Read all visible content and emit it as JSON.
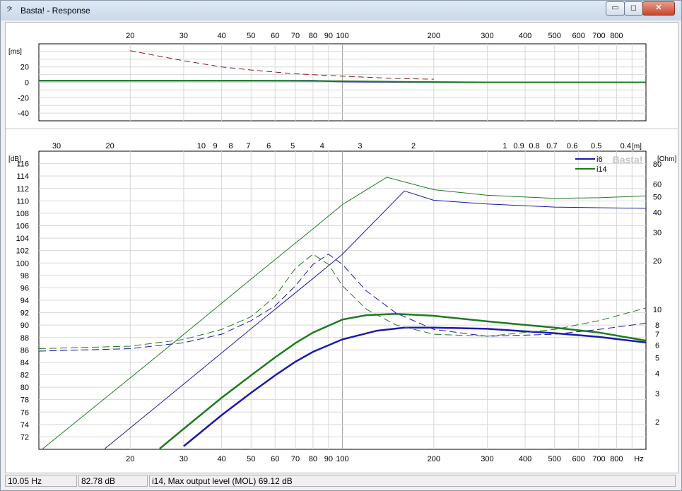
{
  "window": {
    "title": "Basta! - Response",
    "icon": "bass-clef-icon",
    "minimize_glyph": "▭",
    "maximize_glyph": "◻",
    "close_glyph": "✕"
  },
  "colors": {
    "i6": "#1a1aa8",
    "i14": "#1f7a1f",
    "delay_dashed": "#8b1a1a",
    "grid": "#d8d8d8",
    "grid_decade": "#a8a8a8"
  },
  "chart_data": [
    {
      "type": "line",
      "name": "group-delay",
      "x_scale": "log",
      "xlim": [
        10,
        1000
      ],
      "x_ticks": [
        20,
        30,
        40,
        50,
        60,
        70,
        80,
        90,
        100,
        200,
        300,
        400,
        500,
        600,
        700,
        800
      ],
      "y_unit": "[ms]",
      "ylim": [
        -50,
        50
      ],
      "y_ticks": [
        20,
        0,
        -20,
        -40
      ],
      "grid": true,
      "series": [
        {
          "line": "dashed",
          "x": [
            20,
            30,
            40,
            50,
            70,
            100,
            150,
            200
          ],
          "y": [
            41,
            28,
            20,
            16,
            11,
            8,
            5,
            4
          ]
        },
        {
          "line": "solid",
          "x": [
            10,
            50,
            80,
            100,
            150,
            250,
            1000
          ],
          "y": [
            2,
            2,
            2,
            1,
            0.5,
            0,
            0
          ]
        },
        {
          "line": "solid",
          "x": [
            10,
            50,
            100,
            150,
            200,
            300,
            1000
          ],
          "y": [
            2,
            2,
            1.5,
            0.8,
            0.4,
            0,
            0
          ]
        }
      ]
    },
    {
      "type": "line",
      "name": "response",
      "x_scale": "log",
      "xlim": [
        10,
        1000
      ],
      "x_ticks": [
        20,
        30,
        40,
        50,
        60,
        70,
        80,
        90,
        100,
        200,
        300,
        400,
        500,
        600,
        700,
        800
      ],
      "x_unit": "Hz",
      "top_axis_unit": "[m]",
      "top_ticks": [
        "30",
        "20",
        "10",
        "9",
        "8",
        "7",
        "6",
        "5",
        "4",
        "3",
        "2",
        "1",
        "0.9",
        "0.8",
        "0.7",
        "0.6",
        "0.5",
        "0.4"
      ],
      "y_unit": "[dB]",
      "ylim": [
        70,
        118
      ],
      "y_ticks": [
        72,
        74,
        76,
        78,
        80,
        82,
        84,
        86,
        88,
        90,
        92,
        94,
        96,
        98,
        100,
        102,
        104,
        106,
        108,
        110,
        112,
        114,
        116
      ],
      "y2_unit": "[Ohm]",
      "y2_scale": "log",
      "y2_ticks": [
        2,
        3,
        4,
        5,
        6,
        7,
        8,
        10,
        20,
        30,
        40,
        50,
        60,
        80
      ],
      "grid": true,
      "legend": [
        "i6",
        "i14"
      ],
      "legend_position": "top-right",
      "watermark": "Basta!",
      "series": [
        {
          "name": "i6",
          "role": "response",
          "x": [
            30,
            40,
            50,
            60,
            70,
            80,
            100,
            130,
            160,
            200,
            300,
            400,
            500,
            700,
            1000
          ],
          "y": [
            70.5,
            75.5,
            79.1,
            81.9,
            84.1,
            85.7,
            87.7,
            89.1,
            89.6,
            89.6,
            89.4,
            89,
            88.7,
            88.1,
            87.2
          ]
        },
        {
          "name": "i14",
          "role": "response",
          "x": [
            25,
            30,
            40,
            50,
            60,
            70,
            80,
            100,
            120,
            150,
            200,
            300,
            500,
            700,
            1000
          ],
          "y": [
            70.1,
            73.3,
            78.3,
            81.9,
            84.8,
            87.1,
            88.8,
            90.9,
            91.6,
            91.8,
            91.5,
            90.6,
            89.6,
            88.8,
            87.5
          ]
        },
        {
          "name": "i6",
          "role": "max-level",
          "x": [
            16.5,
            30,
            50,
            80,
            100,
            160,
            200,
            300,
            500,
            1000
          ],
          "y": [
            70.1,
            80.5,
            89.4,
            97.5,
            101.4,
            111.6,
            110.1,
            109.5,
            109,
            108.8
          ]
        },
        {
          "name": "i14",
          "role": "max-level",
          "x": [
            10.3,
            20,
            30,
            50,
            80,
            100,
            140,
            200,
            300,
            500,
            700,
            1000
          ],
          "y": [
            70.1,
            81.5,
            88.5,
            97.4,
            105.5,
            109.4,
            113.8,
            111.8,
            110.9,
            110.4,
            110.5,
            110.8
          ]
        },
        {
          "name": "i6",
          "role": "impedance",
          "x": [
            10,
            20,
            30,
            40,
            50,
            60,
            70,
            80,
            90,
            100,
            120,
            150,
            200,
            300,
            500,
            700,
            1000
          ],
          "y": [
            5.5,
            5.7,
            6.2,
            7.0,
            8.5,
            10.5,
            14,
            19,
            22,
            19,
            13,
            9.5,
            7.5,
            6.8,
            7.0,
            7.5,
            8.2
          ]
        },
        {
          "name": "i14",
          "role": "impedance",
          "x": [
            10,
            20,
            30,
            40,
            50,
            60,
            70,
            80,
            90,
            100,
            120,
            150,
            200,
            300,
            500,
            700,
            1000
          ],
          "y": [
            5.7,
            5.9,
            6.5,
            7.5,
            9.0,
            12,
            18,
            22,
            19,
            14,
            10,
            8.0,
            7.0,
            6.8,
            7.5,
            8.5,
            10.2
          ]
        }
      ]
    }
  ],
  "status": {
    "freq": "10.05 Hz",
    "level": "82.78 dB",
    "message": "i14, Max output level (MOL) 69.12 dB"
  }
}
